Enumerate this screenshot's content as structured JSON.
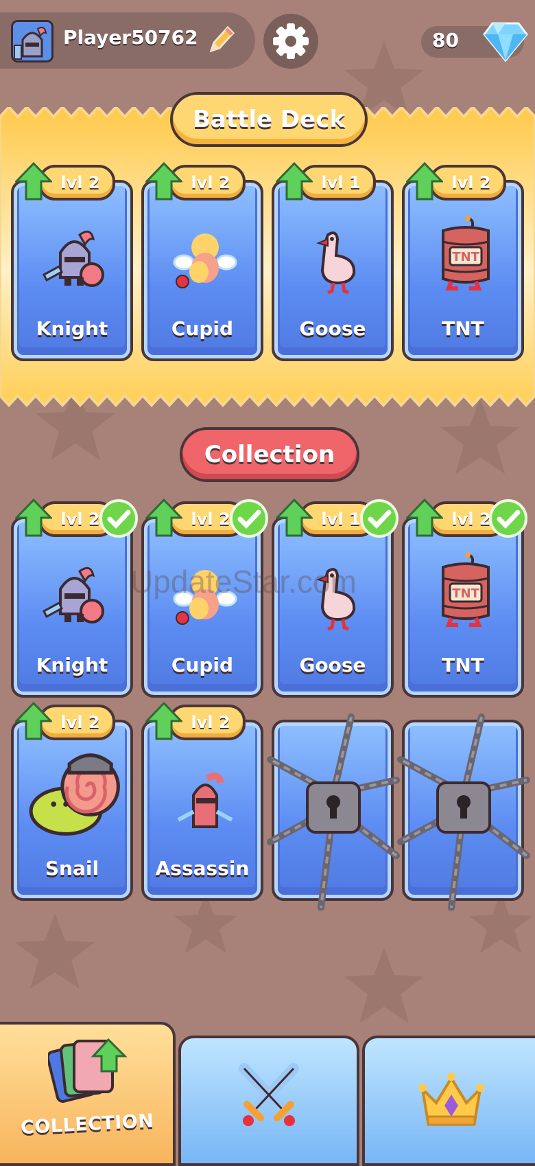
{
  "header": {
    "player_name": "Player50762",
    "gems": "80"
  },
  "battle_deck": {
    "title": "Battle Deck",
    "cards": [
      {
        "name": "Knight",
        "level": "lvl 2"
      },
      {
        "name": "Cupid",
        "level": "lvl 2"
      },
      {
        "name": "Goose",
        "level": "lvl 1"
      },
      {
        "name": "TNT",
        "level": "lvl 2"
      }
    ]
  },
  "collection": {
    "title": "Collection",
    "cards": [
      {
        "name": "Knight",
        "level": "lvl 2",
        "in_deck": true
      },
      {
        "name": "Cupid",
        "level": "lvl 2",
        "in_deck": true
      },
      {
        "name": "Goose",
        "level": "lvl 1",
        "in_deck": true
      },
      {
        "name": "TNT",
        "level": "lvl 2",
        "in_deck": true
      },
      {
        "name": "Snail",
        "level": "lvl 2",
        "in_deck": false
      },
      {
        "name": "Assassin",
        "level": "lvl 2",
        "in_deck": false
      }
    ],
    "locked_slots": 2
  },
  "nav": {
    "collection_label": "COLLECTION",
    "tabs": [
      "collection-icon",
      "crossed-swords-icon",
      "crown-icon"
    ]
  },
  "watermark": "UpdateStar.com",
  "colors": {
    "gold": "#ffd772",
    "red_pill": "#f0656a",
    "card_blue": "#5c8cf2",
    "outline": "#4a3538",
    "check_green": "#6fd64a"
  }
}
